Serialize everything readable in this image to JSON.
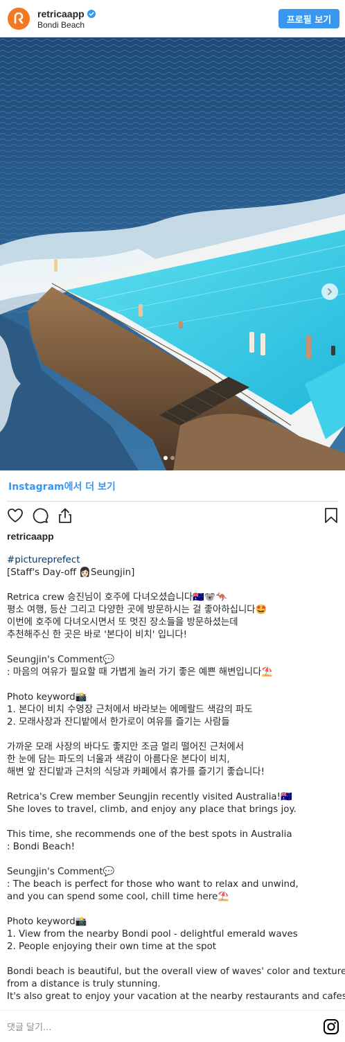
{
  "header": {
    "username": "retricaapp",
    "location": "Bondi Beach",
    "view_profile_label": "프로필 보기"
  },
  "photo": {
    "alt": "Bondi Icebergs pool by the ocean",
    "slide_count": 2,
    "active_slide": 1
  },
  "see_more_label": "Instagram에서 더 보기",
  "post": {
    "username": "retricaapp"
  },
  "caption": {
    "lines": [
      "#pictureprefect",
      "[Staff's Day-off 👩🏻Seungjin]",
      "",
      "Retrica crew 승진님이 호주에 다녀오셨습니다🇦🇺🐨🦘",
      "평소 여행, 등산 그리고 다양한 곳에 방문하시는 걸 좋아하십니다🤩",
      "이번에 호주에 다녀오시면서 또 멋진 장소들을 방문하셨는데",
      "추천해주신 한 곳은 바로 '본다이 비치' 입니다!",
      "",
      "Seungjin's Comment💬",
      ": 마음의 여유가 필요할 때 가볍게 놀러 가기 좋은 예쁜 해변입니다⛱️",
      "",
      "Photo keyword📸",
      "1. 본다이 비치 수영장 근처에서 바라보는 에메랄드 색감의 파도",
      "2. 모래사장과 잔디밭에서 한가로이 여유를 즐기는 사람들",
      "",
      "가까운 모래 사장의 바다도 좋지만 조금 멀리 떨어진 근처에서",
      "한 눈에 담는 파도의 너울과 색감이 아름다운 본다이 비치,",
      "해변 앞 잔디밭과 근처의 식당과 카페에서 휴가를 즐기기 좋습니다!",
      "",
      "Retrica's Crew member Seungjin recently visited Australia!🇦🇺",
      "She loves to travel, climb, and enjoy any place that brings joy.",
      "",
      "This time, she recommends one of the best spots in Australia",
      ": Bondi Beach!",
      "",
      "Seungjin's Comment💬",
      ": The beach is perfect for those who want to relax and unwind,",
      "and you can spend some cool, chill time here⛱️",
      "",
      "Photo keyword📸",
      "1. View from the nearby Bondi pool - delightful emerald waves",
      "2. People enjoying their own time at the spot",
      "",
      "Bondi beach is beautiful, but the overall view of waves' color and textures",
      "from a distance is truly stunning.",
      "It's also great to enjoy your vacation at the nearby restaurants and cafes!"
    ]
  },
  "comment": {
    "placeholder": "댓글 달기..."
  },
  "colors": {
    "accent": "#3897f0",
    "brand": "#f2791f",
    "hashtag": "#00376b"
  }
}
